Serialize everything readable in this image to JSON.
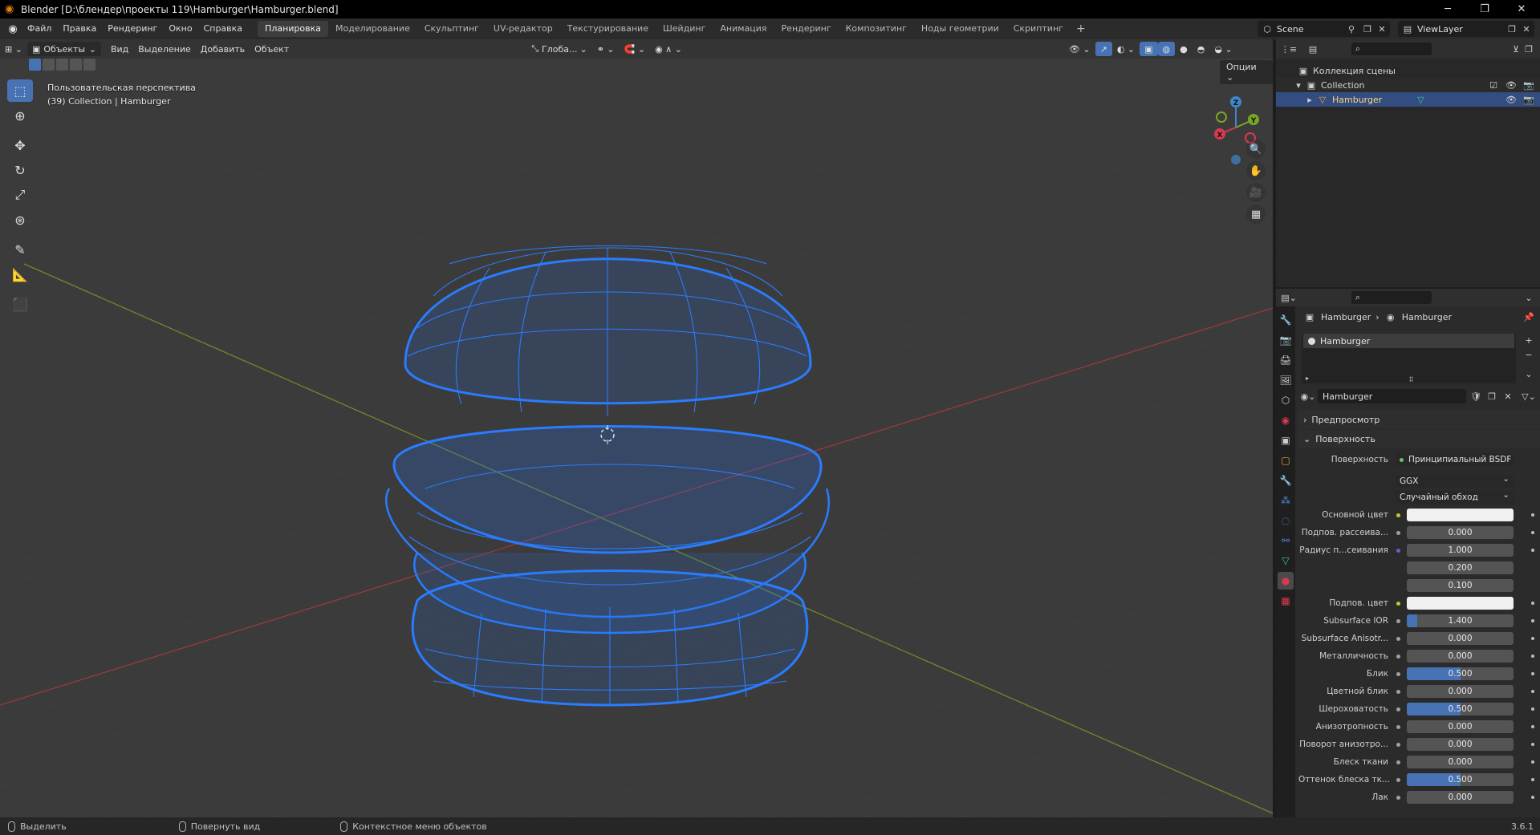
{
  "title_bar": {
    "title": "Blender [D:\\блендер\\проекты 119\\Hamburger\\Hamburger.blend]",
    "minimize": "─",
    "maximize": "❐",
    "close": "✕"
  },
  "menu": {
    "items": [
      "Файл",
      "Правка",
      "Рендеринг",
      "Окно",
      "Справка"
    ]
  },
  "workspaces": {
    "tabs": [
      "Планировка",
      "Моделирование",
      "Скульптинг",
      "UV-редактор",
      "Текстурирование",
      "Шейдинг",
      "Анимация",
      "Рендеринг",
      "Композитинг",
      "Ноды геометрии",
      "Скриптинг"
    ],
    "active": "Планировка",
    "add": "+"
  },
  "scene": {
    "name": "Scene",
    "view_layer": "ViewLayer"
  },
  "viewport": {
    "mode": "Объекты",
    "menus": [
      "Вид",
      "Выделение",
      "Добавить",
      "Объект"
    ],
    "orientation": "Глоба...",
    "options": "Опции",
    "overlay_line1": "Пользовательская перспектива",
    "overlay_line2": "(39) Collection | Hamburger",
    "gizmo": {
      "z": "Z",
      "y": "Y",
      "x": "X"
    },
    "wire_color": "#2a7cff",
    "bg_color": "#3b3b3b"
  },
  "outliner": {
    "root": "Коллекция сцены",
    "collection": "Collection",
    "object": "Hamburger"
  },
  "properties": {
    "breadcrumb_object": "Hamburger",
    "breadcrumb_material": "Hamburger",
    "slot": "Hamburger",
    "material_name": "Hamburger",
    "panel_preview": "Предпросмотр",
    "panel_surface": "Поверхность",
    "surface_label": "Поверхность",
    "surface_value": "Принципиальный BSDF",
    "distribution": "GGX",
    "subsurface_method": "Случайный обход",
    "rows": [
      {
        "label": "Основной цвет",
        "type": "color",
        "color": "#f0f0f0",
        "sock": "#c7c729"
      },
      {
        "label": "Подпов. рассеива...",
        "type": "value",
        "value": "0.000",
        "fill": 0,
        "sock": "#a1a1a1"
      },
      {
        "label": "Радиус п...сеивания",
        "type": "value",
        "value": "1.000",
        "fill": 0,
        "sock": "#6363c7"
      },
      {
        "label": "",
        "type": "value",
        "value": "0.200",
        "fill": 0,
        "sock": ""
      },
      {
        "label": "",
        "type": "value",
        "value": "0.100",
        "fill": 0,
        "sock": ""
      },
      {
        "label": "Подпов. цвет",
        "type": "color",
        "color": "#f0f0f0",
        "sock": "#c7c729"
      },
      {
        "label": "Subsurface IOR",
        "type": "value",
        "value": "1.400",
        "fill": 0.1,
        "sock": "#a1a1a1"
      },
      {
        "label": "Subsurface Anisotr...",
        "type": "value",
        "value": "0.000",
        "fill": 0,
        "sock": "#a1a1a1"
      },
      {
        "label": "Металличность",
        "type": "value",
        "value": "0.000",
        "fill": 0,
        "sock": "#a1a1a1"
      },
      {
        "label": "Блик",
        "type": "value",
        "value": "0.500",
        "fill": 0.5,
        "sock": "#a1a1a1"
      },
      {
        "label": "Цветной блик",
        "type": "value",
        "value": "0.000",
        "fill": 0,
        "sock": "#a1a1a1"
      },
      {
        "label": "Шероховатость",
        "type": "value",
        "value": "0.500",
        "fill": 0.5,
        "sock": "#a1a1a1"
      },
      {
        "label": "Анизотропность",
        "type": "value",
        "value": "0.000",
        "fill": 0,
        "sock": "#a1a1a1"
      },
      {
        "label": "Поворот анизотро...",
        "type": "value",
        "value": "0.000",
        "fill": 0,
        "sock": "#a1a1a1"
      },
      {
        "label": "Блеск ткани",
        "type": "value",
        "value": "0.000",
        "fill": 0,
        "sock": "#a1a1a1"
      },
      {
        "label": "Оттенок блеска тк...",
        "type": "value",
        "value": "0.500",
        "fill": 0.5,
        "sock": "#a1a1a1"
      },
      {
        "label": "Лак",
        "type": "value",
        "value": "0.000",
        "fill": 0,
        "sock": "#a1a1a1"
      }
    ]
  },
  "statusbar": {
    "select": "Выделить",
    "rotate": "Повернуть вид",
    "context": "Контекстное меню объектов",
    "version": "3.6.1"
  }
}
